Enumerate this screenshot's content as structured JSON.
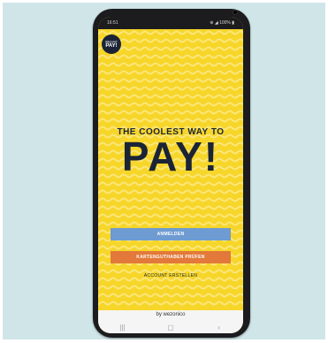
{
  "status_bar": {
    "time": "16:51",
    "indicators": "⊕ ◢ 100% ▮"
  },
  "logo": {
    "line1": "WECHAT",
    "line2": "PAY!"
  },
  "tagline": "THE COOLEST WAY TO",
  "headline": "PAY!",
  "buttons": {
    "login": "ANMELDEN",
    "card": "KARTENGUTHABEN PRÜFEN",
    "create_account": "ACCOUNT ERSTELLEN"
  },
  "footer": {
    "by": "by wezonico"
  },
  "nav": {
    "recent": "|||",
    "home": "▢",
    "back": "‹"
  },
  "colors": {
    "background": "#cfe5e8",
    "screen_yellow": "#f7d62a",
    "navy": "#1b2436",
    "login_button": "#6e9bd1",
    "card_button": "#e2793a"
  }
}
